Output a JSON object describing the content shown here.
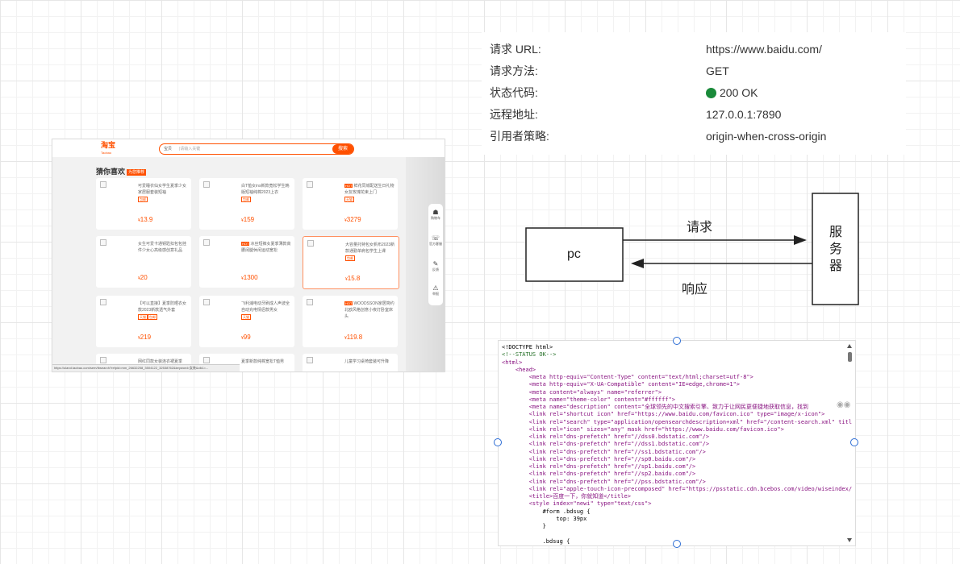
{
  "taobao": {
    "logo": "淘宝",
    "logo_sub": "Taobao",
    "search_label": "宝贝",
    "search_placeholder": "|请输入关键",
    "search_button": "搜索",
    "guess_title": "猜你喜欢",
    "guess_tag": "为您推荐",
    "products": [
      {
        "title": "可爱睡衣仙女学生夏季少女家居服套装短袖",
        "badges": [
          "包邮"
        ],
        "price": "13.9",
        "hot": ""
      },
      {
        "title": "白T恤女ins新款宽松学生韩版短袖纯棉2023上衣",
        "badges": [
          "包邮"
        ],
        "price": "159",
        "hot": ""
      },
      {
        "title": "鲜花同城配送生日礼物女友玫瑰花束上门",
        "badges": [
          "天猫"
        ],
        "price": "3279",
        "hot": "HOT"
      },
      {
        "title": "女生可爱卡通钥匙扣包包挂件少女心高级感创意礼品",
        "badges": [],
        "price": "20",
        "hot": ""
      },
      {
        "title": "冰丝短裤女夏季薄款高腰阔腿休闲运动宽松",
        "badges": [],
        "price": "1300",
        "hot": "HOT"
      },
      {
        "title": "大容量托特包女帆布2023新款通勤单肩包学生上课",
        "badges": [
          "包邮"
        ],
        "price": "15.8",
        "hot": ""
      },
      {
        "title": "【可以直接】夏季防晒衣女款2023新款透气外套",
        "badges": [
          "天猫",
          "包邮"
        ],
        "price": "219",
        "hot": ""
      },
      {
        "title": "飞利浦电动牙刷成人声波全自动充电情侣款男女",
        "badges": [
          "天猫"
        ],
        "price": "99",
        "hot": ""
      },
      {
        "title": "WOODSSON家居简约北欧风格创意小夜灯卧室床头",
        "badges": [],
        "price": "119.8",
        "hot": "HOT"
      }
    ],
    "row4_titles": [
      "网红同款女装连衣裙夏季",
      "夏季新款纯棉宽松T恤男",
      "儿童学习桌椅套装可升降"
    ],
    "sidebar": [
      "购物车",
      "官方客服",
      "反馈",
      "举报"
    ],
    "status_url": "https://uland.taobao.com/sem/tbsearch?refpid=mm_26632258_3504122_32538762&keyword=女装&clk1=..."
  },
  "request": {
    "rows": [
      {
        "label": "请求 URL:",
        "value": "https://www.baidu.com/"
      },
      {
        "label": "请求方法:",
        "value": "GET"
      },
      {
        "label": "状态代码:",
        "value": "200 OK"
      },
      {
        "label": "远程地址:",
        "value": "127.0.0.1:7890"
      },
      {
        "label": "引用者策略:",
        "value": "origin-when-cross-origin"
      }
    ]
  },
  "diagram": {
    "pc": "pc",
    "request": "请求",
    "response": "响应",
    "server": [
      "服",
      "务",
      "器"
    ]
  },
  "code_lines": [
    "<!DOCTYPE html>",
    "<!--STATUS OK-->",
    "<html>",
    "    <head>",
    "        <meta http-equiv=\"Content-Type\" content=\"text/html;charset=utf-8\">",
    "        <meta http-equiv=\"X-UA-Compatible\" content=\"IE=edge,chrome=1\">",
    "        <meta content=\"always\" name=\"referrer\">",
    "        <meta name=\"theme-color\" content=\"#ffffff\">",
    "        <meta name=\"description\" content=\"全球领先的中文搜索引擎、致力于让网民更便捷地获取信息，找到",
    "        <link rel=\"shortcut icon\" href=\"https://www.baidu.com/favicon.ico\" type=\"image/x-icon\">",
    "        <link rel=\"search\" type=\"application/opensearchdescription+xml\" href=\"/content-search.xml\" titl",
    "        <link rel=\"icon\" sizes=\"any\" mask href=\"https://www.baidu.com/favicon.ico\">",
    "        <link rel=\"dns-prefetch\" href=\"//dss0.bdstatic.com\"/>",
    "        <link rel=\"dns-prefetch\" href=\"//dss1.bdstatic.com\"/>",
    "        <link rel=\"dns-prefetch\" href=\"//ss1.bdstatic.com\"/>",
    "        <link rel=\"dns-prefetch\" href=\"//sp0.baidu.com\"/>",
    "        <link rel=\"dns-prefetch\" href=\"//sp1.baidu.com\"/>",
    "        <link rel=\"dns-prefetch\" href=\"//sp2.baidu.com\"/>",
    "        <link rel=\"dns-prefetch\" href=\"//pss.bdstatic.com\"/>",
    "        <link rel=\"apple-touch-icon-precomposed\" href=\"https://psstatic.cdn.bcebos.com/video/wiseindex/",
    "        <title>百度一下，你就知道</title>",
    "        <style index=\"newi\" type=\"text/css\">",
    "            #form .bdsug {",
    "                top: 39px",
    "            }",
    "",
    "            .bdsug {"
  ],
  "colors": {
    "accent": "#ff5000",
    "status_ok": "#1a8a3a"
  },
  "icons": [
    "search-icon",
    "cart-icon",
    "service-icon",
    "feedback-icon",
    "report-icon"
  ]
}
